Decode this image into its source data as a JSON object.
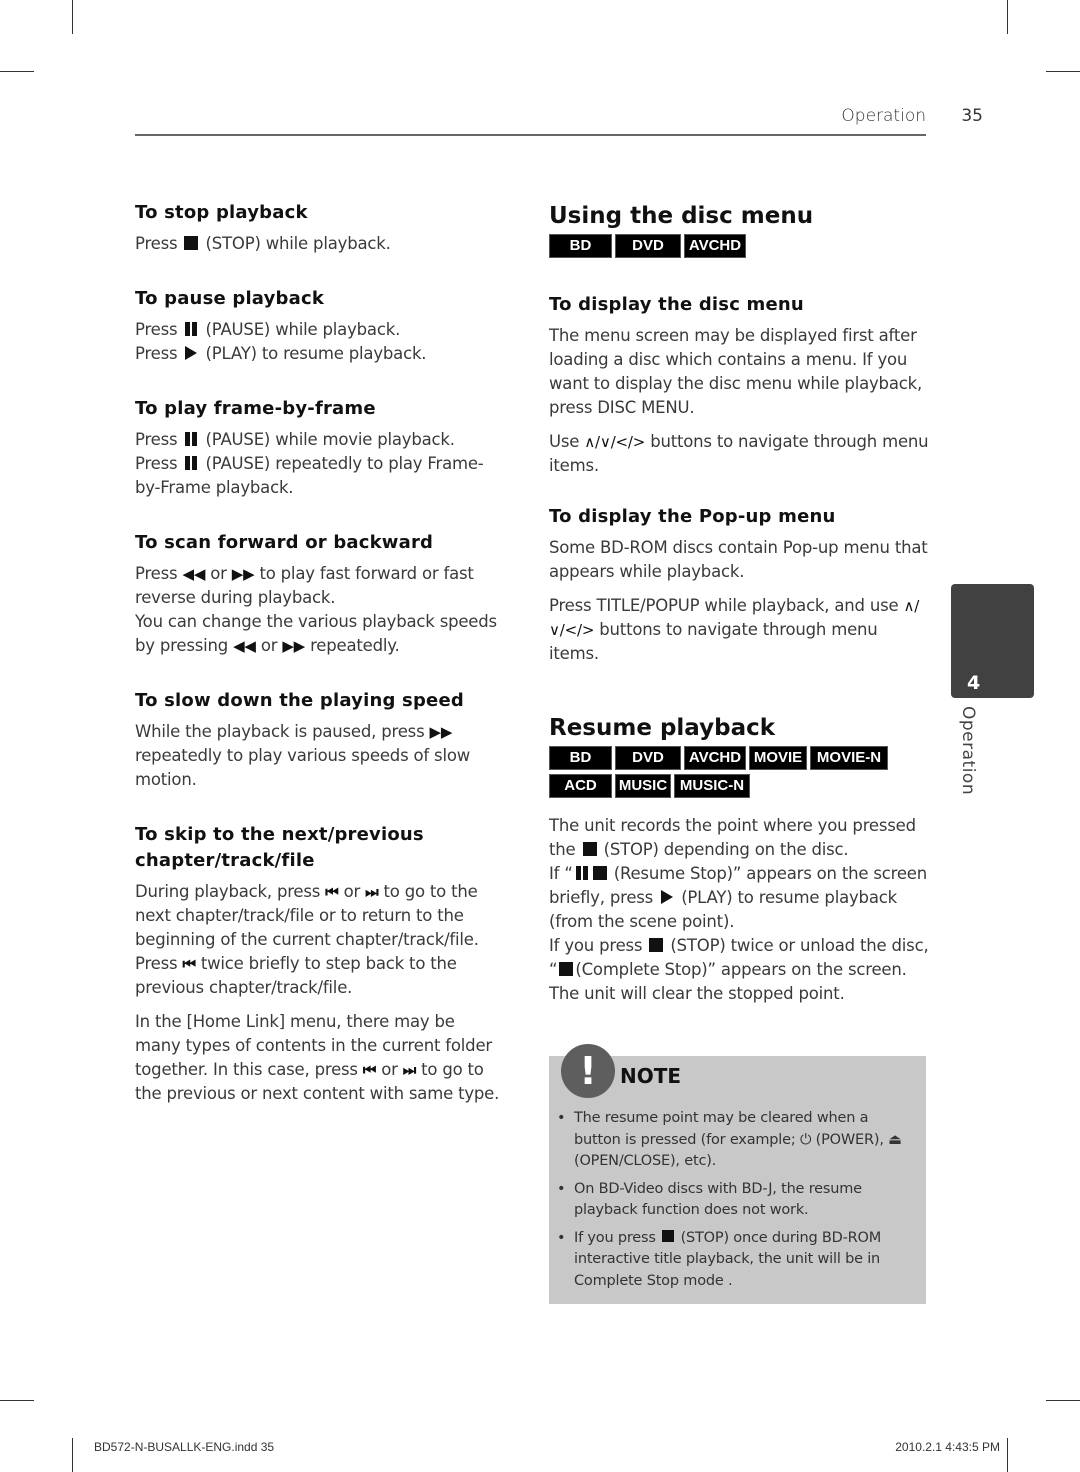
{
  "header": {
    "section": "Operation",
    "page_number": "35"
  },
  "left_column": {
    "stop": {
      "heading": "To stop playback",
      "lines": [
        {
          "pre": "Press",
          "icon": "stop-icon",
          "post": "(STOP) while playback."
        }
      ]
    },
    "pause": {
      "heading": "To pause playback",
      "lines": [
        {
          "pre": "Press",
          "icon": "pause-icon",
          "post": "(PAUSE) while playback."
        },
        {
          "pre": "Press",
          "icon": "play-icon",
          "post": "(PLAY) to resume playback."
        }
      ]
    },
    "frame": {
      "heading": "To play frame-by-frame",
      "line1_pre": "Press",
      "line1_post": "(PAUSE) while movie playback.",
      "line2_pre": "Press",
      "line2_post": "(PAUSE) repeatedly to play Frame-by-Frame playback."
    },
    "scan": {
      "heading": "To scan forward or backward",
      "p1_a": "Press",
      "p1_b": "or",
      "p1_c": "to play fast forward or fast reverse during playback.",
      "p2_a": "You can change the various playback speeds by pressing",
      "p2_b": "or",
      "p2_c": "repeatedly.",
      "rew_symbol": "◀◀",
      "ff_symbol": "▶▶"
    },
    "slow": {
      "heading": "To slow down the playing speed",
      "p_a": "While the playback is paused, press",
      "p_b": "repeatedly to play various speeds of slow motion.",
      "ff_symbol": "▶▶"
    },
    "skip": {
      "heading": "To skip to the next/previous chapter/track/file",
      "p1_a": "During playback, press",
      "p1_b": "or",
      "p1_c": "to go to the next chapter/track/file or to return to the beginning of the current chapter/track/file.",
      "p1_d": "Press",
      "p1_e": "twice briefly to step back to the previous chapter/track/file.",
      "p2_a": "In the [Home Link] menu, there may be many types of contents in the current folder together. In this case, press",
      "p2_b": "or",
      "p2_c": "to go to the previous or next content with same type.",
      "prev_symbol": "⏮",
      "next_symbol": "⏭"
    }
  },
  "right_column": {
    "disc_menu": {
      "title": "Using the disc menu",
      "badges": [
        "BD",
        "DVD",
        "AVCHD"
      ],
      "display_heading": "To display the disc menu",
      "display_text": "The menu screen may be displayed first after loading a disc which contains a menu. If you want to display the disc menu while playback, press DISC MENU.",
      "nav_pre": "Use",
      "nav_symbols": "∧/∨/</>",
      "nav_post": "buttons to navigate through menu items.",
      "popup_heading": "To display the Pop-up menu",
      "popup_text1": "Some BD-ROM discs contain Pop-up menu that appears while playback.",
      "popup_text2_pre": "Press TITLE/POPUP while playback, and use",
      "popup_nav_symbols": "∧/∨/</>",
      "popup_text2_post": "buttons to navigate through menu items."
    },
    "resume": {
      "title": "Resume playback",
      "badges": [
        "BD",
        "DVD",
        "AVCHD",
        "MOVIE",
        "MOVIE-N",
        "ACD",
        "MUSIC",
        "MUSIC-N"
      ],
      "p_a": "The unit records the point where you pressed the",
      "p_b": "(STOP) depending on the disc.",
      "p_c": "If “",
      "p_d": "(Resume Stop)” appears on the screen briefly, press",
      "p_e": "(PLAY) to resume playback (from the scene point).",
      "p_f": "If you press",
      "p_g": "(STOP) twice or unload the disc, “",
      "p_h": "(Complete Stop)” appears on the screen. The unit will clear the stopped point."
    },
    "note": {
      "title": "NOTE",
      "icon": "!",
      "items": [
        {
          "a": "The resume point may be cleared when a button is pressed (for example;",
          "power": "⏻",
          "b": "(POWER),",
          "eject": "⏏",
          "c": "(OPEN/CLOSE), etc)."
        },
        {
          "a": "On BD-Video discs with BD-J, the resume playback function does not work."
        },
        {
          "a": "If you press",
          "b": "(STOP) once during BD-ROM interactive title playback, the unit will be in Complete Stop mode ."
        }
      ],
      "bullet": "•"
    }
  },
  "side_tab": {
    "number": "4",
    "label": "Operation"
  },
  "footer": {
    "file": "BD572-N-BUSALLK-ENG.indd   35",
    "timestamp": "2010.2.1   4:43:5 PM"
  }
}
